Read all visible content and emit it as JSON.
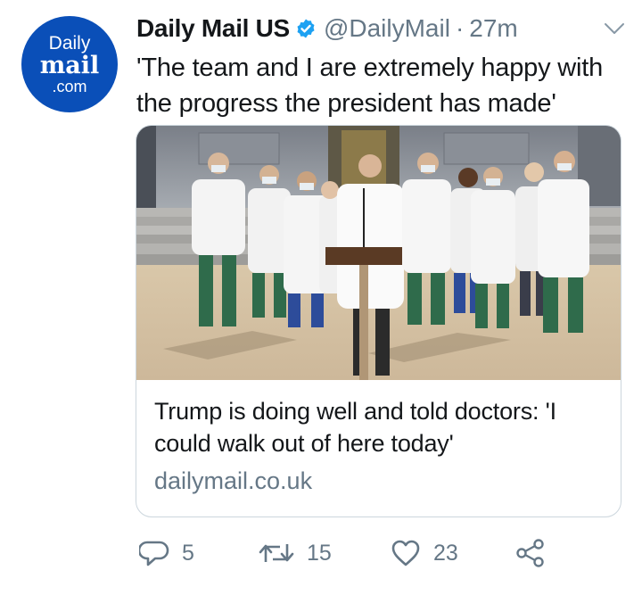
{
  "tweet": {
    "author": {
      "name": "Daily Mail US",
      "handle": "@DailyMail",
      "time": "27m",
      "avatar": {
        "line1": "Daily",
        "line2": "mail",
        "line3": ".com"
      }
    },
    "text": "'The team and I are extremely happy with the progress the president has made'",
    "card": {
      "title": "Trump is doing well and told doctors: 'I could walk out of here today'",
      "domain": "dailymail.co.uk"
    },
    "actions": {
      "replies": "5",
      "retweets": "15",
      "likes": "23"
    }
  },
  "colors": {
    "brand_blue": "#0a4fb8",
    "verified_blue": "#1da1f2",
    "secondary_text": "#657786",
    "border": "#ccd6dd"
  },
  "icons": [
    "verified-badge-icon",
    "chevron-down-icon",
    "reply-icon",
    "retweet-icon",
    "like-icon",
    "share-icon"
  ]
}
